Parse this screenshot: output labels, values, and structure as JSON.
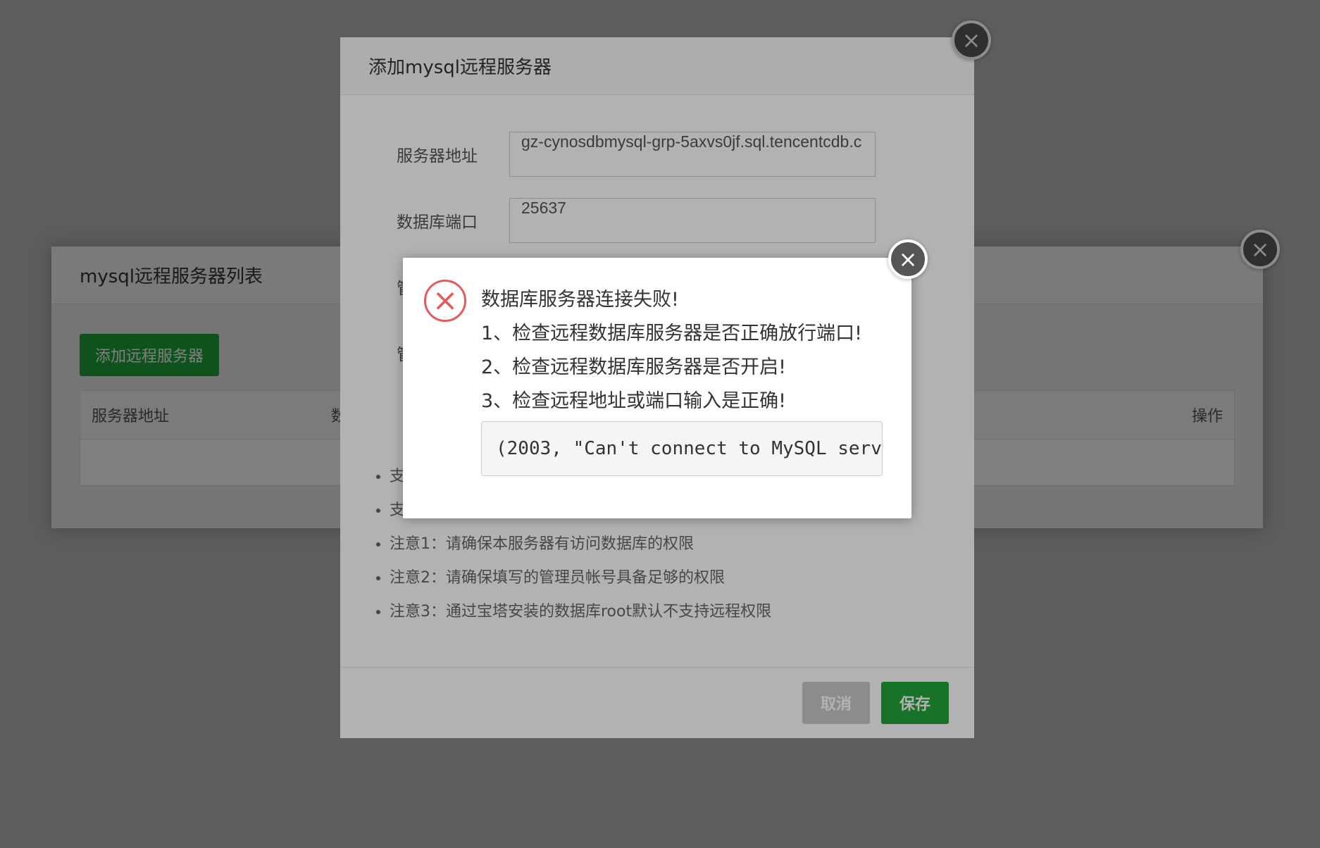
{
  "list_dialog": {
    "title": "mysql远程服务器列表",
    "add_button": "添加远程服务器",
    "columns": [
      "服务器地址",
      "数",
      "操作"
    ]
  },
  "add_dialog": {
    "title": "添加mysql远程服务器",
    "fields": [
      {
        "label": "服务器地址",
        "value": "gz-cynosdbmysql-grp-5axvs0jf.sql.tencentcdb.c"
      },
      {
        "label": "数据库端口",
        "value": "25637"
      },
      {
        "label": "管"
      },
      {
        "label": "管"
      }
    ],
    "notes": [
      "支",
      "支",
      "注意1：请确保本服务器有访问数据库的权限",
      "注意2：请确保填写的管理员帐号具备足够的权限",
      "注意3：通过宝塔安装的数据库root默认不支持远程权限"
    ],
    "cancel_label": "取消",
    "save_label": "保存"
  },
  "alert": {
    "lines": [
      "数据库服务器连接失败!",
      "1、检查远程数据库服务器是否正确放行端口!",
      "2、检查远程数据库服务器是否开启!",
      "3、检查远程地址或端口输入是正确!"
    ],
    "error_text": "(2003, \"Can't connect to MySQL serv"
  },
  "icons": {
    "close": "close-icon",
    "error": "error-x-icon"
  },
  "colors": {
    "primary": "#20a53a",
    "error": "#e25c5c",
    "close_bg": "#555555"
  }
}
